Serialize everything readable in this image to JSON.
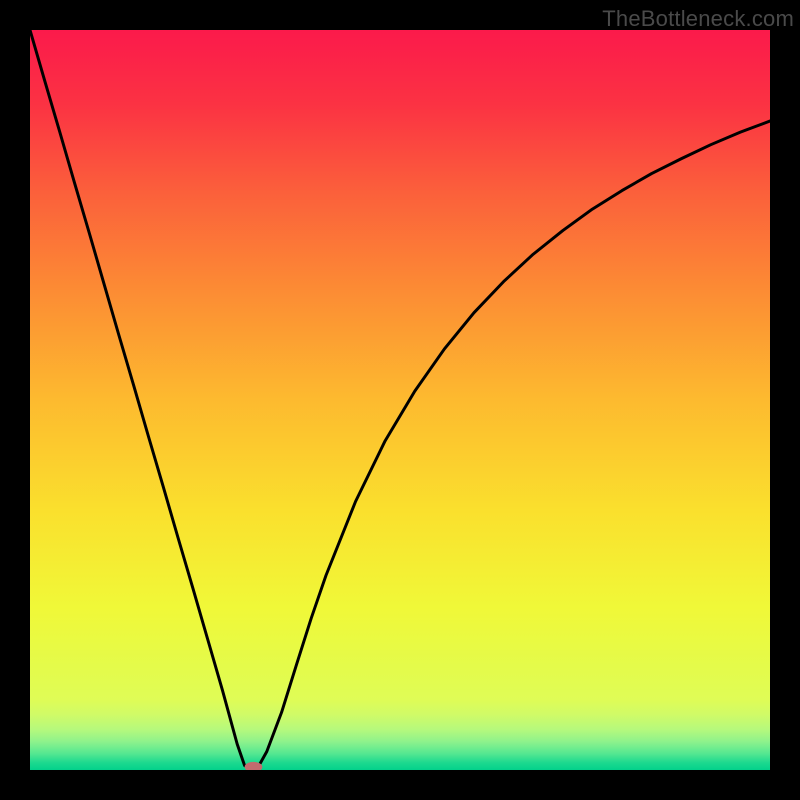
{
  "watermark": "TheBottleneck.com",
  "chart_data": {
    "type": "line",
    "title": "",
    "xlabel": "",
    "ylabel": "",
    "xlim": [
      0,
      100
    ],
    "ylim": [
      0,
      100
    ],
    "grid": false,
    "series": [
      {
        "name": "bottleneck-curve",
        "x": [
          0,
          2,
          4,
          6,
          8,
          10,
          12,
          14,
          16,
          18,
          20,
          22,
          24,
          26,
          28,
          29,
          30,
          31,
          32,
          34,
          36,
          38,
          40,
          44,
          48,
          52,
          56,
          60,
          64,
          68,
          72,
          76,
          80,
          84,
          88,
          92,
          96,
          100
        ],
        "values": [
          100,
          93.1,
          86.3,
          79.4,
          72.6,
          65.7,
          58.8,
          52.0,
          45.1,
          38.3,
          31.4,
          24.6,
          17.7,
          10.8,
          3.5,
          0.6,
          0.0,
          0.7,
          2.5,
          7.8,
          14.2,
          20.5,
          26.3,
          36.3,
          44.5,
          51.2,
          56.9,
          61.8,
          66.0,
          69.7,
          72.9,
          75.8,
          78.3,
          80.6,
          82.6,
          84.5,
          86.2,
          87.7
        ]
      }
    ],
    "marker": {
      "x": 30.2,
      "y": 0.4,
      "color": "#c26b6e",
      "rx": 1.2,
      "ry": 0.7
    },
    "background_gradient": {
      "stops": [
        {
          "offset": 0.0,
          "color": "#fb1a4b"
        },
        {
          "offset": 0.1,
          "color": "#fb3243"
        },
        {
          "offset": 0.22,
          "color": "#fb603b"
        },
        {
          "offset": 0.35,
          "color": "#fc8b34"
        },
        {
          "offset": 0.5,
          "color": "#fdba2f"
        },
        {
          "offset": 0.65,
          "color": "#fae02d"
        },
        {
          "offset": 0.78,
          "color": "#f0f838"
        },
        {
          "offset": 0.86,
          "color": "#e4fb4a"
        },
        {
          "offset": 0.905,
          "color": "#dffc56"
        },
        {
          "offset": 0.925,
          "color": "#d0fb67"
        },
        {
          "offset": 0.945,
          "color": "#b6f97c"
        },
        {
          "offset": 0.962,
          "color": "#8df28c"
        },
        {
          "offset": 0.978,
          "color": "#54e791"
        },
        {
          "offset": 0.99,
          "color": "#1dd98f"
        },
        {
          "offset": 1.0,
          "color": "#03d18b"
        }
      ]
    }
  }
}
